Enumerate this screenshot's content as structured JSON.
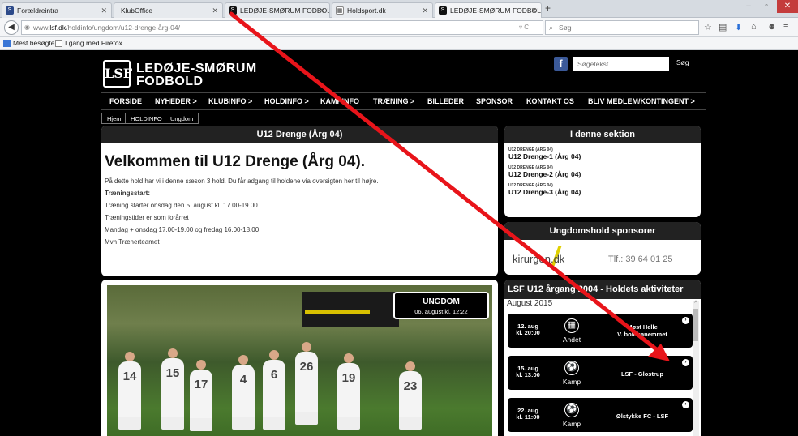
{
  "browser": {
    "tabs": [
      {
        "label": "Forældreintra",
        "favicon": "lsf-icon"
      },
      {
        "label": "KlubOffice",
        "favicon": "blank-page-icon"
      },
      {
        "label": "LEDØJE-SMØRUM FODBOLD",
        "favicon": "lsf-icon"
      },
      {
        "label": "Holdsport.dk",
        "favicon": "grid-icon"
      },
      {
        "label": "LEDØJE-SMØRUM FODBOLD",
        "favicon": "lsf-icon"
      }
    ],
    "new_tab": "+",
    "url_prefix": "www.",
    "url_domain": "lsf.dk",
    "url_path": "/holdinfo/ungdom/u12-drenge-årg-04/",
    "search_placeholder": "Søg",
    "bookmarks": [
      "Mest besøgte",
      "I gang med Firefox"
    ]
  },
  "site": {
    "club_line1": "LEDØJE-SMØRUM",
    "club_line2": "FODBOLD",
    "logo_text": "LSF",
    "fb_label": "f",
    "search_placeholder": "Søgetekst",
    "search_button": "Søg",
    "nav": [
      "FORSIDE",
      "NYHEDER >",
      "KLUBINFO >",
      "HOLDINFO >",
      "KAMPINFO",
      "TRÆNING >",
      "BILLEDER",
      "SPONSOR",
      "KONTAKT OS",
      "BLIV MEDLEM/KONTINGENT >"
    ],
    "breadcrumbs": [
      "Hjem",
      "HOLDINFO",
      "Ungdom"
    ]
  },
  "intro": {
    "header": "U12 Drenge (Årg 04)",
    "heading": "Velkommen til U12 Drenge (Årg 04).",
    "lines": [
      "På dette hold har vi i denne sæson 3 hold. Du får adgang til holdene via oversigten her til højre.",
      "Træningsstart:",
      "Træning starter onsdag den 5. august kl. 17.00-19.00.",
      "Træningstider er som forårret",
      "Mandag + onsdag 17.00-19.00 og fredag 16.00-18.00",
      "Mvh Trænerteamet"
    ]
  },
  "section": {
    "header": "I denne sektion",
    "items": [
      {
        "small": "U12 DRENGE (ÅRG 04)",
        "big": "U12 Drenge-1 (Årg 04)"
      },
      {
        "small": "U12 DRENGE (ÅRG 04)",
        "big": "U12 Drenge-2 (Årg 04)"
      },
      {
        "small": "U12 DRENGE (ÅRG 04)",
        "big": "U12 Drenge-3 (Årg 04)"
      }
    ]
  },
  "sponsor": {
    "header": "Ungdomshold sponsorer",
    "name": "kirurgen.dk",
    "phone": "Tlf.: 39 64 01 25"
  },
  "photo": {
    "caption_title": "UNGDOM",
    "caption_date": "06. august kl. 12:22",
    "jersey_numbers": [
      "14",
      "15",
      "17",
      "4",
      "6",
      "26",
      "19",
      "23"
    ]
  },
  "activities": {
    "header": "LSF U12 årgang 2004 - Holdets aktiviteter",
    "month": "August 2015",
    "events": [
      {
        "date1": "12. aug",
        "date2": "kl. 20:00",
        "type": "Andet",
        "icon": "calendar-icon",
        "title": "Møst Helle\nV. boldbanemmet"
      },
      {
        "date1": "15. aug",
        "date2": "kl. 13:00",
        "type": "Kamp",
        "icon": "football-icon",
        "title": "LSF - Glostrup"
      },
      {
        "date1": "22. aug",
        "date2": "kl. 11:00",
        "type": "Kamp",
        "icon": "football-icon",
        "title": "Ølstykke FC - LSF"
      }
    ]
  },
  "annotation": {
    "color": "#e8141a"
  }
}
